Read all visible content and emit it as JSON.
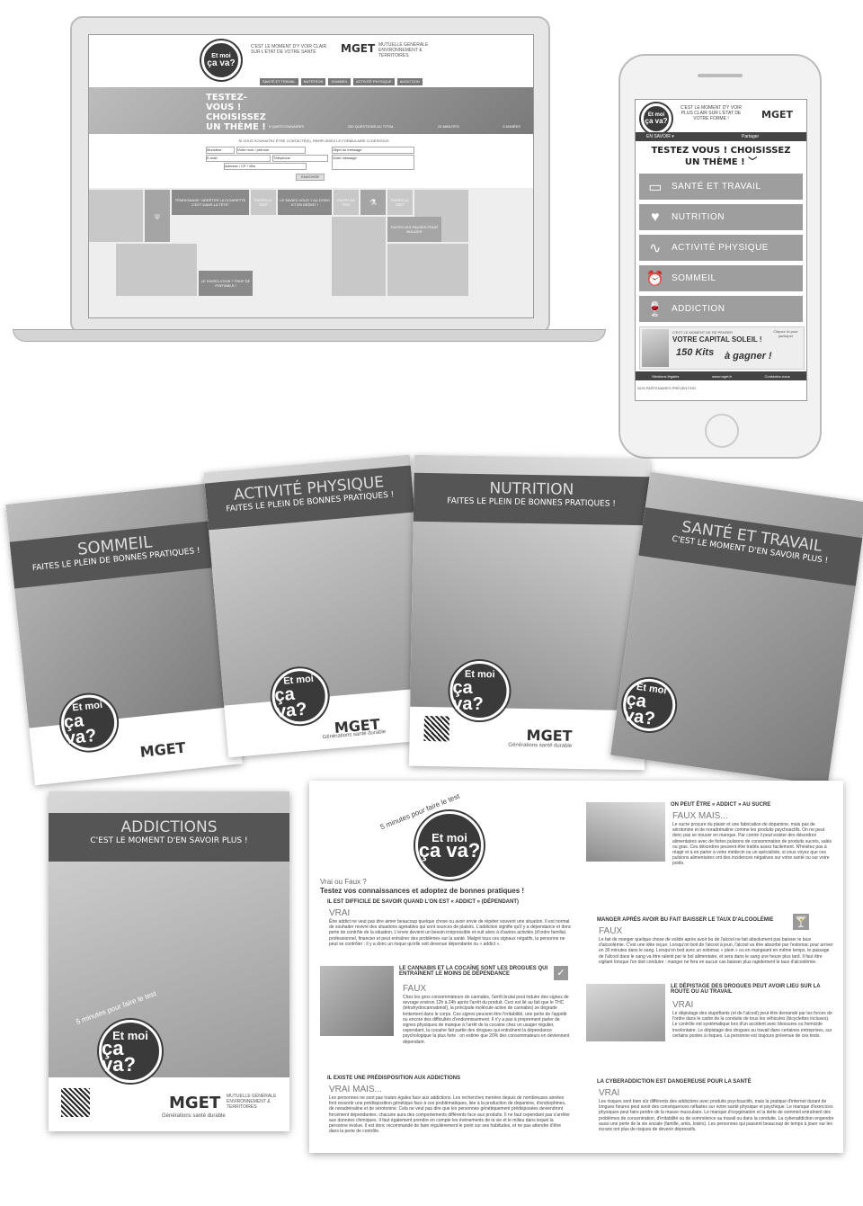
{
  "laptop": {
    "tagline": "C'EST LE MOMENT D'Y VOIR CLAIR SUR L'ÉTAT DE VOTRE SANTÉ",
    "brand": "MGET",
    "brand_sub": "MUTUELLE GÉNÉRALE ENVIRONNEMENT & TERRITOIRES",
    "logo_line1": "Et moi",
    "logo_line2": "ça va?",
    "nav": [
      "SANTÉ ET TRAVAIL",
      "NUTRITION",
      "SOMMEIL",
      "ACTIVITÉ PHYSIQUE",
      "ADDICTION"
    ],
    "hero_text": "TESTEZ-VOUS ! CHOISISSEZ UN THÈME !",
    "hero_stats": [
      "5 QUESTIONNAIRES",
      "250 QUESTIONS AU TOTAL",
      "25 MINUTES",
      "5 ANNÉES"
    ],
    "form_title": "SI VOUS SOUHAITEZ ÊTRE CONTACTÉ(E), REMPLISSEZ LE FORMULAIRE CI-DESSOUS",
    "form_fields": [
      "Monsieur",
      "Votre nom / prénom",
      "E-mail",
      "Téléphone",
      "Adresse / CP / Ville",
      "Objet du message",
      "Votre message"
    ],
    "send_label": "ENVOYER",
    "tiles": [
      "TÉMOIGNAGE \"ARRÊTER LA CIGARETTE C'EST DANS LA TÊTE\"",
      "FAITES LE TEST",
      "LE SAVIEZ-VOUS ? AU DODO ET EN DÉSINT !",
      "FAITES LE TEST",
      "FAITES LE TEST",
      "FAITES LES PAUSES POUR BOUGER",
      "LE SAVIEZ-VOUS ? TROP DE PORTABLE !"
    ]
  },
  "phone": {
    "tagline": "C'EST LE MOMENT D'Y VOIR PLUS CLAIR SUR L'ÉTAT DE VOTRE FORME !",
    "brand": "MGET",
    "logo_line1": "Et moi",
    "logo_line2": "ça va?",
    "en_savoir": "EN SAVOIR ▾",
    "partager": "Partager",
    "headline": "TESTEZ VOUS ! CHOISISSEZ UN THÈME !",
    "chevron": "﹀",
    "menu": [
      {
        "label": "SANTÉ ET TRAVAIL",
        "icon": "▭"
      },
      {
        "label": "NUTRITION",
        "icon": "♥"
      },
      {
        "label": "ACTIVITÉ PHYSIQUE",
        "icon": "∿"
      },
      {
        "label": "SOMMEIL",
        "icon": "⏰"
      },
      {
        "label": "ADDICTION",
        "icon": "🍷"
      }
    ],
    "promo_line1": "C'EST LE MOMENT DE RE PENSER",
    "promo_line2": "VOTRE CAPITAL SOLEIL !",
    "promo_line3": "150 Kits",
    "promo_line4": "à gagner !",
    "promo_badge": "Cliquez ici pour participer",
    "footer": [
      "Mentions légales",
      "www.mget.fr",
      "Contactez-nous"
    ],
    "partners": "NOS PARTENAIRES PRÉVENTION"
  },
  "posters": {
    "sommeil": {
      "title": "SOMMEIL",
      "subtitle": "FAITES LE PLEIN DE BONNES PRATIQUES !"
    },
    "activite": {
      "title": "ACTIVITÉ PHYSIQUE",
      "subtitle": "FAITES LE PLEIN DE BONNES PRATIQUES !"
    },
    "nutrition": {
      "title": "NUTRITION",
      "subtitle": "FAITES LE PLEIN DE BONNES PRATIQUES !"
    },
    "sante": {
      "title": "SANTÉ ET TRAVAIL",
      "subtitle": "C'EST LE MOMENT D'EN SAVOIR PLUS !"
    },
    "addictions": {
      "title": "ADDICTIONS",
      "subtitle": "C'EST LE MOMENT D'EN SAVOIR PLUS !"
    },
    "arc": "5 minutes pour faire le test",
    "logo_line1": "Et moi",
    "logo_line2": "ça va?",
    "brand": "MGET",
    "brand_sub": "MUTUELLE GÉNÉRALE ENVIRONNEMENT & TERRITOIRES",
    "baseline": "Générations santé durable"
  },
  "leaflet": {
    "arc": "5 minutes pour faire le test",
    "logo_line1": "Et moi",
    "logo_line2": "ça va?",
    "intro1": "Vrai ou Faux ?",
    "intro2": "Testez vos connaissances et adoptez de bonnes pratiques !",
    "q1": "IL EST DIFFICILE DE SAVOIR QUAND L'ON EST « ADDICT » (DÉPENDANT)",
    "v1": "VRAI",
    "t1": "Être addict ne veut pas dire aimer beaucoup quelque chose ou avoir envie de répéter souvent une situation. Il est normal de souhaiter revivre des situations agréables qui sont sources de plaisirs. L'addiction signifie qu'il y a dépendance et donc perte de contrôle de la situation. L'envie devient un besoin irrépressible et nuit alors à d'autres activités (d'ordre familial, professionnel, financier et peut entraîner des problèmes sur la santé. Malgré tous ces signaux négatifs, la personne ne peut se contrôler : il y a donc un risque qu'elle soit devenue dépendante ou « addict ».",
    "q2": "LE CANNABIS ET LA COCAÏNE SONT LES DROGUES QUI ENTRAÎNENT LE MOINS DE DÉPENDANCE",
    "v2": "FAUX",
    "t2": "Chez les gros consommateurs de cannabis, l'arrêt brutal peut induire des signes de sevrage environ 12h à 24h après l'arrêt du produit. Ceci est lié au fait que le THC (tétrahydrocannabinol), la principale molécule active de cannabis) se dégrade lentement dans le corps. Ces signes peuvent être l'irritabilité, une perte de l'appétit ou encore des difficultés d'endormissement. Il n'y a pas à proprement parler de signes physiques de manque à l'arrêt de la cocaïne chez un usager régulier, cependant, la cocaïne fait partie des drogues qui entraînent la dépendance psychologique la plus forte : on estime que 20% des consommateurs en deviennent dépendant.",
    "q3": "IL EXISTE UNE PRÉDISPOSITION AUX ADDICTIONS",
    "v3": "VRAI MAIS...",
    "t3": "Les personnes ne sont pas toutes égales face aux addictions. Les recherches menées depuis de nombreuses années font ressortir une prédisposition génétique face à ces problématiques, liée à la production de dopamine, d'endorphines, de noradrénaline et de sérotonine. Cela ne veut pas dire que les personnes génétiquement prédisposées deviendront forcément dépendantes, chacune aura des comportements différents face aux produits. Il ne faut cependant pas s'arrêter aux données chimiques. Il faut également prendre en compte les événements de la vie et le milieu dans lequel la personne évolue. Il est donc recommandé de faire régulièrement le point sur ses habitudes, et ne pas attendre d'être dans la perte de contrôle.",
    "q4": "ON PEUT ÊTRE « ADDICT » AU SUCRE",
    "v4": "FAUX MAIS...",
    "t4": "Le sucre procure du plaisir et une fabrication de dopamine, mais pas de sérotonine et de noradrénaline comme les produits psychoactifs. On ne peut donc pas se trouver en manque. Par contre il peut exister des désordres alimentaires avec de fortes pulsions de consommation de produits sucrés, salés ou gras. Ces désordres peuvent être traités assez facilement. N'hésitez pas à réagir et à en parler à votre médecin ou un spécialiste, si vous voyez que ces pulsions alimentaires ont des incidences négatives sur votre santé ou sur votre poids.",
    "q5": "MANGER APRÈS AVOIR BU FAIT BAISSER LE TAUX D'ALCOOLÉMIE",
    "v5": "FAUX",
    "t5": "Le fait de manger quelque chose de solide après avoir bu de l'alcool ne fait absolument pas baisser le taux d'alcoolémie. C'est une idée reçue. Lorsqu'on boit de l'alcool à jeun, l'alcool va être absorbé par l'estomac pour arriver en 30 minutes dans le sang. Lorsqu'on boit avec un estomac « plein » ou en mangeant en même temps, le passage de l'alcool dans le sang va être ralenti par le bol alimentaire, et sera dans le sang une heure plus tard. Il faut être vigilant lorsque l'on doit conduire : manger ne fera en aucun cas baisser plus rapidement le taux d'alcoolémie.",
    "q6": "LE DÉPISTAGE DES DROGUES PEUT AVOIR LIEU SUR LA ROUTE OU AU TRAVAIL",
    "v6": "VRAI",
    "t6": "Le dépistage des stupéfiants (et de l'alcool) peut être demandé par les forces de l'ordre dans le cadre de la conduite de tous les véhicules (bicyclettes incluses). Le contrôle est systématique lors d'un accident avec blessures ou homicide involontaire. Le dépistage des drogues au travail dans certaines entreprises, sur certains postes à risques. La personne est toujours prévenue de ces tests.",
    "q7": "LA CYBERADDICTION EST DANGEREUSE POUR LA SANTÉ",
    "v7": "VRAI",
    "t7": "Les risques sont bien sûr différents des addictions avec produits psychoactifs, mais la pratique d'internet durant de longues heures peut avoir des conséquences néfastes sur notre santé physique et psychique. Le manque d'exercices physiques peut faire perdre de la masse musculaire. Le manque d'oxygénation et la dette de sommeil entraînent des problèmes de concentration, d'irritabilité ou de somnolence au travail ou dans la conduite. La cyberaddiction engendre aussi une perte de la vie sociale (famille, amis, loisirs). Les personnes qui passent beaucoup de temps à jouer sur les écrans ont plus de risques de devenir dépressifs."
  }
}
